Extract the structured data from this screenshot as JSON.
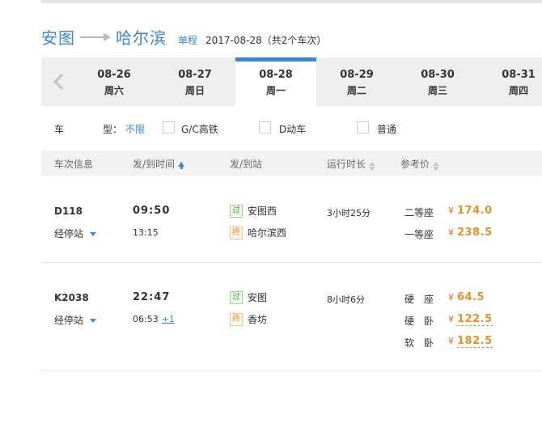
{
  "header": {
    "from_city": "安图",
    "to_city": "哈尔滨",
    "trip_type": "单程",
    "date_summary": "2017-08-28（共2个车次）"
  },
  "date_tabs": [
    {
      "date": "08-26",
      "weekday": "周六"
    },
    {
      "date": "08-27",
      "weekday": "周日"
    },
    {
      "date": "08-28",
      "weekday": "周一",
      "active": true
    },
    {
      "date": "08-29",
      "weekday": "周二"
    },
    {
      "date": "08-30",
      "weekday": "周三"
    },
    {
      "date": "08-31",
      "weekday": "周四"
    }
  ],
  "filter": {
    "label_left": "车",
    "label_right": "型：",
    "selected": "不限",
    "options": [
      "G/C高铁",
      "D动车",
      "普通"
    ]
  },
  "table_headers": {
    "train": "车次信息",
    "time": "发/到时间",
    "station": "发/到站",
    "duration": "运行时长",
    "price": "参考价"
  },
  "trains": [
    {
      "number": "D118",
      "stops_label": "经停站",
      "depart": "09:50",
      "arrive": "13:15",
      "next_day": "",
      "from_tag": "过",
      "from_station": "安图西",
      "to_tag": "终",
      "to_station": "哈尔滨西",
      "duration": "3小时25分",
      "seats": [
        {
          "name": "二等座",
          "currency": "¥",
          "price": "174.0"
        },
        {
          "name": "一等座",
          "currency": "¥",
          "price": "238.5"
        }
      ]
    },
    {
      "number": "K2038",
      "stops_label": "经停站",
      "depart": "22:47",
      "arrive": "06:53",
      "next_day": "+1",
      "from_tag": "过",
      "from_station": "安图",
      "to_tag": "终",
      "to_station": "香坊",
      "duration": "8小时6分",
      "seats": [
        {
          "name": "硬　座",
          "currency": "¥",
          "price": "64.5"
        },
        {
          "name": "硬　卧",
          "currency": "¥",
          "price": "122.5"
        },
        {
          "name": "软　卧",
          "currency": "¥",
          "price": "182.5"
        }
      ]
    }
  ],
  "colors": {
    "accent": "#3b86d6",
    "price": "#e8912b"
  }
}
